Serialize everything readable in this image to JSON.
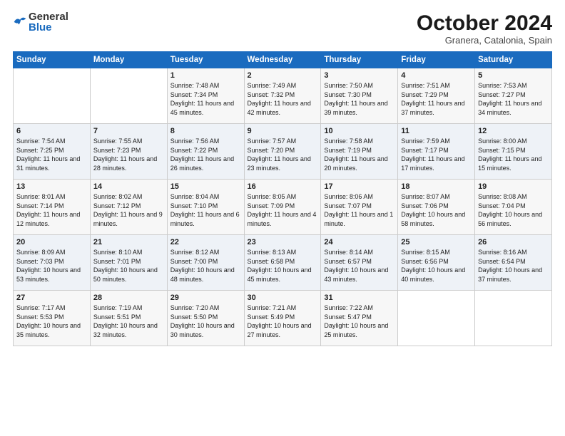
{
  "header": {
    "logo": {
      "general": "General",
      "blue": "Blue"
    },
    "title": "October 2024",
    "location": "Granera, Catalonia, Spain"
  },
  "weekdays": [
    "Sunday",
    "Monday",
    "Tuesday",
    "Wednesday",
    "Thursday",
    "Friday",
    "Saturday"
  ],
  "weeks": [
    [
      {
        "day": "",
        "content": ""
      },
      {
        "day": "",
        "content": ""
      },
      {
        "day": "1",
        "content": "Sunrise: 7:48 AM\nSunset: 7:34 PM\nDaylight: 11 hours and 45 minutes."
      },
      {
        "day": "2",
        "content": "Sunrise: 7:49 AM\nSunset: 7:32 PM\nDaylight: 11 hours and 42 minutes."
      },
      {
        "day": "3",
        "content": "Sunrise: 7:50 AM\nSunset: 7:30 PM\nDaylight: 11 hours and 39 minutes."
      },
      {
        "day": "4",
        "content": "Sunrise: 7:51 AM\nSunset: 7:29 PM\nDaylight: 11 hours and 37 minutes."
      },
      {
        "day": "5",
        "content": "Sunrise: 7:53 AM\nSunset: 7:27 PM\nDaylight: 11 hours and 34 minutes."
      }
    ],
    [
      {
        "day": "6",
        "content": "Sunrise: 7:54 AM\nSunset: 7:25 PM\nDaylight: 11 hours and 31 minutes."
      },
      {
        "day": "7",
        "content": "Sunrise: 7:55 AM\nSunset: 7:23 PM\nDaylight: 11 hours and 28 minutes."
      },
      {
        "day": "8",
        "content": "Sunrise: 7:56 AM\nSunset: 7:22 PM\nDaylight: 11 hours and 26 minutes."
      },
      {
        "day": "9",
        "content": "Sunrise: 7:57 AM\nSunset: 7:20 PM\nDaylight: 11 hours and 23 minutes."
      },
      {
        "day": "10",
        "content": "Sunrise: 7:58 AM\nSunset: 7:19 PM\nDaylight: 11 hours and 20 minutes."
      },
      {
        "day": "11",
        "content": "Sunrise: 7:59 AM\nSunset: 7:17 PM\nDaylight: 11 hours and 17 minutes."
      },
      {
        "day": "12",
        "content": "Sunrise: 8:00 AM\nSunset: 7:15 PM\nDaylight: 11 hours and 15 minutes."
      }
    ],
    [
      {
        "day": "13",
        "content": "Sunrise: 8:01 AM\nSunset: 7:14 PM\nDaylight: 11 hours and 12 minutes."
      },
      {
        "day": "14",
        "content": "Sunrise: 8:02 AM\nSunset: 7:12 PM\nDaylight: 11 hours and 9 minutes."
      },
      {
        "day": "15",
        "content": "Sunrise: 8:04 AM\nSunset: 7:10 PM\nDaylight: 11 hours and 6 minutes."
      },
      {
        "day": "16",
        "content": "Sunrise: 8:05 AM\nSunset: 7:09 PM\nDaylight: 11 hours and 4 minutes."
      },
      {
        "day": "17",
        "content": "Sunrise: 8:06 AM\nSunset: 7:07 PM\nDaylight: 11 hours and 1 minute."
      },
      {
        "day": "18",
        "content": "Sunrise: 8:07 AM\nSunset: 7:06 PM\nDaylight: 10 hours and 58 minutes."
      },
      {
        "day": "19",
        "content": "Sunrise: 8:08 AM\nSunset: 7:04 PM\nDaylight: 10 hours and 56 minutes."
      }
    ],
    [
      {
        "day": "20",
        "content": "Sunrise: 8:09 AM\nSunset: 7:03 PM\nDaylight: 10 hours and 53 minutes."
      },
      {
        "day": "21",
        "content": "Sunrise: 8:10 AM\nSunset: 7:01 PM\nDaylight: 10 hours and 50 minutes."
      },
      {
        "day": "22",
        "content": "Sunrise: 8:12 AM\nSunset: 7:00 PM\nDaylight: 10 hours and 48 minutes."
      },
      {
        "day": "23",
        "content": "Sunrise: 8:13 AM\nSunset: 6:58 PM\nDaylight: 10 hours and 45 minutes."
      },
      {
        "day": "24",
        "content": "Sunrise: 8:14 AM\nSunset: 6:57 PM\nDaylight: 10 hours and 43 minutes."
      },
      {
        "day": "25",
        "content": "Sunrise: 8:15 AM\nSunset: 6:56 PM\nDaylight: 10 hours and 40 minutes."
      },
      {
        "day": "26",
        "content": "Sunrise: 8:16 AM\nSunset: 6:54 PM\nDaylight: 10 hours and 37 minutes."
      }
    ],
    [
      {
        "day": "27",
        "content": "Sunrise: 7:17 AM\nSunset: 5:53 PM\nDaylight: 10 hours and 35 minutes."
      },
      {
        "day": "28",
        "content": "Sunrise: 7:19 AM\nSunset: 5:51 PM\nDaylight: 10 hours and 32 minutes."
      },
      {
        "day": "29",
        "content": "Sunrise: 7:20 AM\nSunset: 5:50 PM\nDaylight: 10 hours and 30 minutes."
      },
      {
        "day": "30",
        "content": "Sunrise: 7:21 AM\nSunset: 5:49 PM\nDaylight: 10 hours and 27 minutes."
      },
      {
        "day": "31",
        "content": "Sunrise: 7:22 AM\nSunset: 5:47 PM\nDaylight: 10 hours and 25 minutes."
      },
      {
        "day": "",
        "content": ""
      },
      {
        "day": "",
        "content": ""
      }
    ]
  ]
}
